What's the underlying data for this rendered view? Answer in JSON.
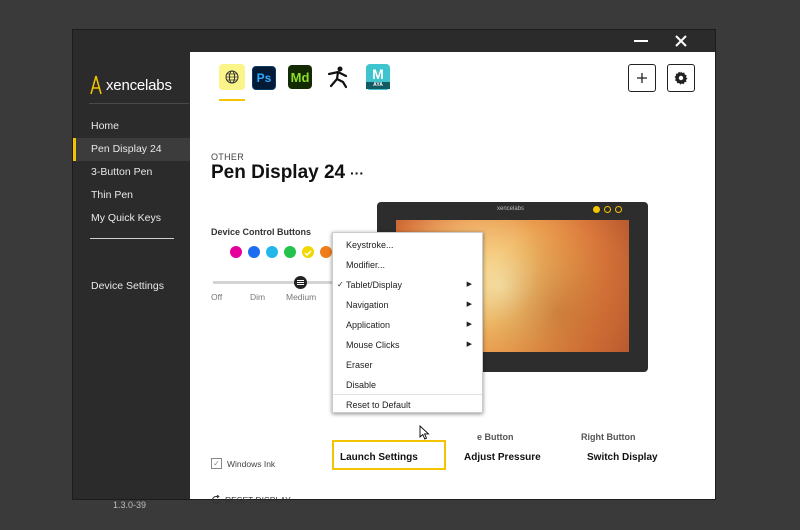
{
  "window": {
    "minimize_label": "minimize",
    "close_label": "close"
  },
  "sidebar": {
    "logo_text": "xencelabs",
    "items": [
      {
        "label": "Home"
      },
      {
        "label": "Pen Display 24",
        "active": true
      },
      {
        "label": "3-Button Pen"
      },
      {
        "label": "Thin Pen"
      },
      {
        "label": "My Quick Keys"
      }
    ],
    "device_settings": "Device Settings",
    "version": "1.3.0-39"
  },
  "app_tabs": [
    {
      "name": "globe-icon"
    },
    {
      "name": "photoshop-icon",
      "text": "Ps"
    },
    {
      "name": "substance-designer-icon",
      "text": "Md"
    },
    {
      "name": "zbrush-icon"
    },
    {
      "name": "maya-icon",
      "text": "M",
      "subtext": "AYA"
    }
  ],
  "header": {
    "section": "OTHER",
    "title": "Pen Display 24",
    "more": "···"
  },
  "device_controls": {
    "label": "Device Control Buttons",
    "swatch_colors": [
      "#e6009b",
      "#1e6cf0",
      "#22b7e8",
      "#23c34e",
      "#f0d800",
      "#f07d1a",
      "#f0401a"
    ],
    "brightness_labels": [
      "Off",
      "Dim",
      "Medium"
    ],
    "brightness_value": "Medium"
  },
  "tablet": {
    "logo_text": "xencelabs"
  },
  "pen_buttons": {
    "middle": {
      "label": "e Button",
      "value": "Adjust Pressure"
    },
    "right": {
      "label": "Right Button",
      "value": "Switch Display"
    },
    "launch_value": "Launch Settings"
  },
  "windows_ink": {
    "label": "Windows Ink",
    "checked": true
  },
  "reset_display": "RESET DISPLAY",
  "context_menu": {
    "items": [
      {
        "label": "Keystroke..."
      },
      {
        "label": "Modifier..."
      },
      {
        "label": "Tablet/Display",
        "checked": true,
        "submenu": true
      },
      {
        "label": "Navigation",
        "submenu": true
      },
      {
        "label": "Application",
        "submenu": true
      },
      {
        "label": "Mouse Clicks",
        "submenu": true
      },
      {
        "label": "Eraser"
      },
      {
        "label": "Disable"
      },
      {
        "label": "Reset to Default"
      }
    ]
  },
  "colors": {
    "accent": "#f5c400",
    "sidebar": "#2b2b2b",
    "background": "#3a3a3a"
  }
}
